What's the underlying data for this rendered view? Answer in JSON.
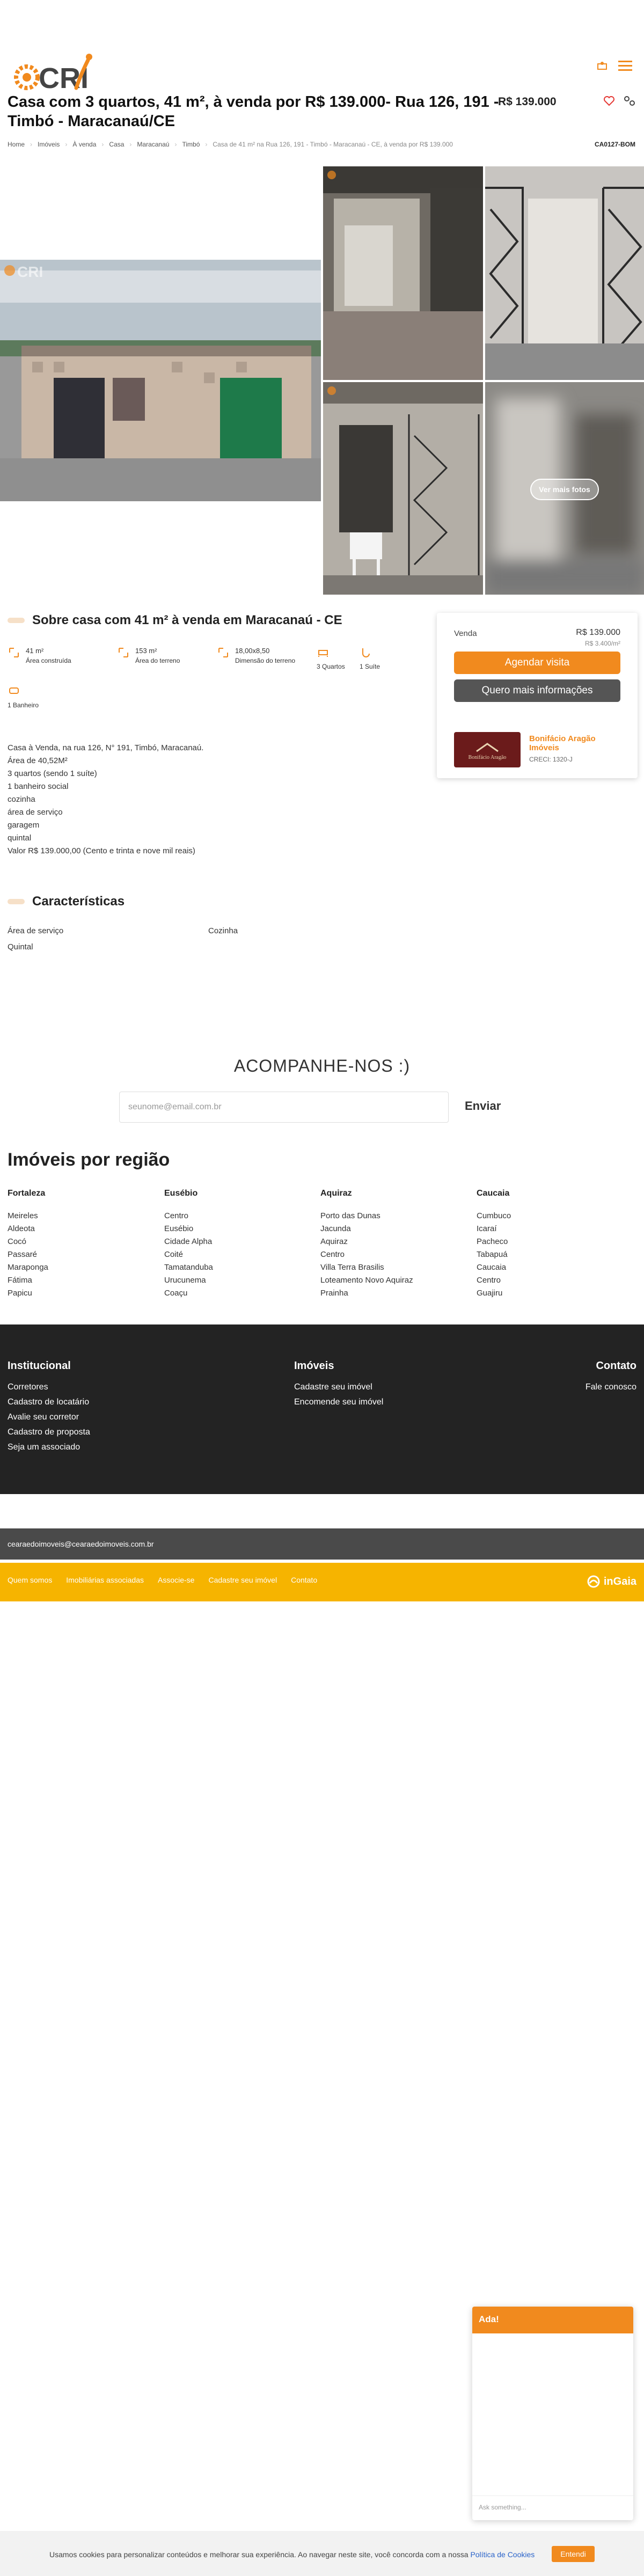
{
  "header": {
    "logo_text": "CRI",
    "title": "Casa com 3 quartos, 41 m², à venda por R$ 139.000- Rua 126, 191 - Timbó - Maracanaú/CE",
    "price": "R$ 139.000"
  },
  "breadcrumb": {
    "items": [
      "Home",
      "Imóveis",
      "À venda",
      "Casa",
      "Maracanaú",
      "Timbó"
    ],
    "current": "Casa de 41 m² na Rua 126, 191 - Timbó - Maracanaú - CE, à venda por R$ 139.000",
    "ref": "CA0127-BOM"
  },
  "photos": {
    "more_label": "Ver mais fotos"
  },
  "about": {
    "title": "Sobre casa com 41 m² à venda em Maracanaú - CE",
    "features": [
      {
        "value": "41 m²",
        "label": "Área construída"
      },
      {
        "value": "153 m²",
        "label": "Área do terreno"
      },
      {
        "value": "18,00x8,50",
        "label": "Dimensão do terreno"
      },
      {
        "value": "",
        "label": "3 Quartos"
      },
      {
        "value": "",
        "label": "1 Suíte"
      },
      {
        "value": "",
        "label": "1 Banheiro"
      }
    ],
    "description": [
      "Casa à Venda, na rua 126, N° 191, Timbó, Maracanaú.",
      "Área de 40,52M²",
      "3 quartos (sendo 1 suíte)",
      "1 banheiro social",
      "cozinha",
      "área de serviço",
      "garagem",
      "quintal",
      "Valor R$ 139.000,00 (Cento e trinta e nove mil reais)"
    ]
  },
  "card": {
    "type": "Venda",
    "price": "R$ 139.000",
    "price_m2": "R$ 3.400/m²",
    "btn_schedule": "Agendar visita",
    "btn_info": "Quero mais informações",
    "agency_name": "Bonifácio Aragão Imóveis",
    "agency_creci": "CRECI: 1320-J",
    "agency_logo_text": "Bonifácio Aragão"
  },
  "characteristics": {
    "title": "Características",
    "items": [
      "Área de serviço",
      "Cozinha",
      "Quintal"
    ]
  },
  "newsletter": {
    "title": "ACOMPANHE-NOS :)",
    "placeholder": "seunome@email.com.br",
    "send": "Enviar"
  },
  "regions": {
    "title": "Imóveis por região",
    "columns": [
      {
        "name": "Fortaleza",
        "items": [
          "Meireles",
          "Aldeota",
          "Cocó",
          "Passaré",
          "Maraponga",
          "Fátima",
          "Papicu"
        ]
      },
      {
        "name": "Eusébio",
        "items": [
          "Centro",
          "Eusébio",
          "Cidade Alpha",
          "Coité",
          "Tamatanduba",
          "Urucunema",
          "Coaçu"
        ]
      },
      {
        "name": "Aquiraz",
        "items": [
          "Porto das Dunas",
          "Jacunda",
          "Aquiraz",
          "Centro",
          "Villa Terra Brasilis",
          "Loteamento Novo Aquiraz",
          "Prainha"
        ]
      },
      {
        "name": "Caucaia",
        "items": [
          "Cumbuco",
          "Icaraí",
          "Pacheco",
          "Tabapuá",
          "Caucaia",
          "Centro",
          "Guajiru"
        ]
      }
    ]
  },
  "footer": {
    "col1": {
      "title": "Institucional",
      "items": [
        "Corretores",
        "Cadastro de locatário",
        "Avalie seu corretor",
        "Cadastro de proposta",
        "Seja um associado"
      ]
    },
    "col2": {
      "title": "Imóveis",
      "items": [
        "Cadastre seu imóvel",
        "Encomende seu imóvel"
      ]
    },
    "col3": {
      "title": "Contato",
      "items": [
        "Fale conosco"
      ]
    },
    "email": "cearaedoimoveis@cearaedoimoveis.com.br",
    "links": [
      "Quem somos",
      "Imobiliárias associadas",
      "Associe-se",
      "Cadastre seu imóvel",
      "Contato"
    ],
    "brand": "inGaia"
  },
  "chat": {
    "title": "Ada!",
    "placeholder": "Ask something..."
  },
  "cookie": {
    "text": "Usamos cookies para personalizar conteúdos e melhorar sua experiência. Ao navegar neste site, você concorda com a nossa",
    "link": "Política de Cookies",
    "button": "Entendi"
  },
  "colors": {
    "accent": "#f18a1e",
    "footer_bg": "#232323",
    "yellow_bar": "#f6b400"
  }
}
